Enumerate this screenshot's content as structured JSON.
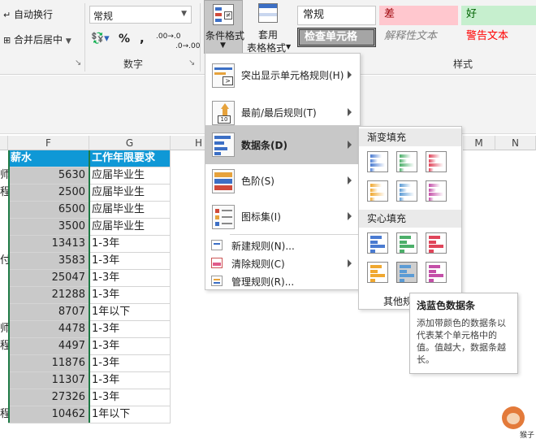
{
  "ribbon": {
    "wrap_text": "自动换行",
    "merge_center": "合并后居中",
    "number_format": "常规",
    "percent_symbol": "%",
    "comma_symbol": ",",
    "increase_decimal": ".00→.0",
    "decrease_decimal": ".0→.00",
    "number_group": "数字",
    "conditional_format_line1": "条件格式",
    "table_format_line1": "套用",
    "table_format_line2": "表格格式",
    "styles_group": "样式",
    "styles": [
      {
        "label": "常规"
      },
      {
        "label": "差"
      },
      {
        "label": "好"
      },
      {
        "label": "检查单元格"
      },
      {
        "label": "解释性文本"
      },
      {
        "label": "警告文本"
      }
    ]
  },
  "columns": {
    "F": "F",
    "G": "G",
    "H": "H",
    "M": "M",
    "N": "N"
  },
  "table": {
    "header_salary": "薪水",
    "header_years": "工作年限要求",
    "left_fragments": [
      "师",
      "程",
      "付",
      "师",
      "程",
      "程"
    ],
    "rows": [
      {
        "salary": "5630",
        "years": "应届毕业生"
      },
      {
        "salary": "2500",
        "years": "应届毕业生"
      },
      {
        "salary": "6500",
        "years": "应届毕业生"
      },
      {
        "salary": "3500",
        "years": "应届毕业生"
      },
      {
        "salary": "13413",
        "years": "1-3年"
      },
      {
        "salary": "3583",
        "years": "1-3年"
      },
      {
        "salary": "25047",
        "years": "1-3年"
      },
      {
        "salary": "21288",
        "years": "1-3年"
      },
      {
        "salary": "8707",
        "years": "1年以下"
      },
      {
        "salary": "4478",
        "years": "1-3年"
      },
      {
        "salary": "4497",
        "years": "1-3年"
      },
      {
        "salary": "11876",
        "years": "1-3年"
      },
      {
        "salary": "11307",
        "years": "1-3年"
      },
      {
        "salary": "27326",
        "years": "1-3年"
      },
      {
        "salary": "10462",
        "years": "1年以下"
      }
    ]
  },
  "menu": {
    "items": [
      {
        "label": "突出显示单元格规则(H)"
      },
      {
        "label": "最前/最后规则(T)"
      },
      {
        "label": "数据条(D)"
      },
      {
        "label": "色阶(S)"
      },
      {
        "label": "图标集(I)"
      }
    ],
    "small_items": [
      {
        "label": "新建规则(N)..."
      },
      {
        "label": "清除规则(C)"
      },
      {
        "label": "管理规则(R)..."
      }
    ],
    "icon_text_2": "10"
  },
  "submenu": {
    "gradient_header": "渐变填充",
    "solid_header": "实心填充",
    "other_rules": "其他规"
  },
  "tooltip": {
    "title": "浅蓝色数据条",
    "body": "添加带颜色的数据条以代表某个单元格中的值。值越大，数据条越长。"
  },
  "watermark": "猴子",
  "colors": {
    "header_blue": "#0f98d6",
    "selected_gray": "#c9c9c9",
    "green_border": "#1e7a45",
    "style_bad_bg": "#ffc7ce",
    "style_bad_fg": "#9c0006",
    "style_good_bg": "#c6efce",
    "style_good_fg": "#006100",
    "warning_red": "#ff0000"
  }
}
